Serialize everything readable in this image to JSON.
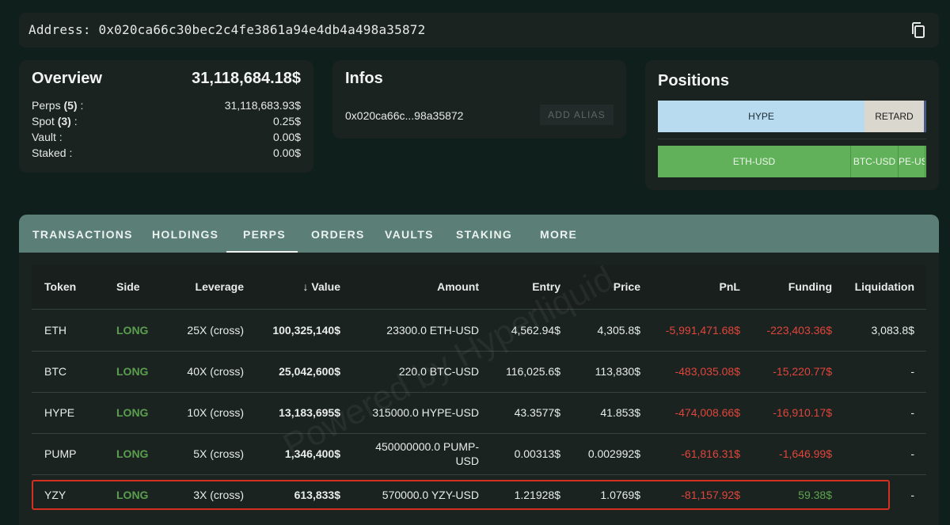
{
  "address_bar": {
    "text": "Address: 0x020ca66c30bec2c4fe3861a94e4db4a498a35872",
    "copy_icon": "copy-icon"
  },
  "overview": {
    "title": "Overview",
    "total": "31,118,684.18$",
    "rows": [
      {
        "label": "Perps",
        "count": "(5)",
        "suffix": " :",
        "value": "31,118,683.93$"
      },
      {
        "label": "Spot",
        "count": "(3)",
        "suffix": " :",
        "value": "0.25$"
      },
      {
        "label": "Vault",
        "count": "",
        "suffix": " :",
        "value": "0.00$"
      },
      {
        "label": "Staked",
        "count": "",
        "suffix": " :",
        "value": "0.00$"
      }
    ]
  },
  "infos": {
    "title": "Infos",
    "short_address": "0x020ca66c...98a35872",
    "alias_button": "ADD ALIAS"
  },
  "positions": {
    "title": "Positions",
    "spot_segments": [
      "HYPE",
      "RETARD"
    ],
    "perp_segments": [
      "ETH-USD",
      "BTC-USD",
      "PE-US"
    ]
  },
  "tabs": [
    "TRANSACTIONS",
    "HOLDINGS",
    "PERPS",
    "ORDERS",
    "VAULTS",
    "STAKING",
    "MORE"
  ],
  "active_tab": "PERPS",
  "table": {
    "headers": {
      "token": "Token",
      "side": "Side",
      "leverage": "Leverage",
      "value_arrow": "↓",
      "value": "Value",
      "amount": "Amount",
      "entry": "Entry",
      "price": "Price",
      "pnl": "PnL",
      "funding": "Funding",
      "liquidation": "Liquidation"
    },
    "rows": [
      {
        "token": "ETH",
        "side": "LONG",
        "leverage": "25X (cross)",
        "value": "100,325,140$",
        "amount": "23300.0 ETH-USD",
        "entry": "4,562.94$",
        "price": "4,305.8$",
        "pnl": "-5,991,471.68$",
        "funding": "-223,403.36$",
        "liquidation": "3,083.8$"
      },
      {
        "token": "BTC",
        "side": "LONG",
        "leverage": "40X (cross)",
        "value": "25,042,600$",
        "amount": "220.0 BTC-USD",
        "entry": "116,025.6$",
        "price": "113,830$",
        "pnl": "-483,035.08$",
        "funding": "-15,220.77$",
        "liquidation": "-"
      },
      {
        "token": "HYPE",
        "side": "LONG",
        "leverage": "10X (cross)",
        "value": "13,183,695$",
        "amount": "315000.0 HYPE-USD",
        "entry": "43.3577$",
        "price": "41.853$",
        "pnl": "-474,008.66$",
        "funding": "-16,910.17$",
        "liquidation": "-"
      },
      {
        "token": "PUMP",
        "side": "LONG",
        "leverage": "5X (cross)",
        "value": "1,346,400$",
        "amount": "450000000.0 PUMP-USD",
        "entry": "0.00313$",
        "price": "0.002992$",
        "pnl": "-61,816.31$",
        "funding": "-1,646.99$",
        "liquidation": "-"
      },
      {
        "token": "YZY",
        "side": "LONG",
        "leverage": "3X (cross)",
        "value": "613,833$",
        "amount": "570000.0 YZY-USD",
        "entry": "1.21928$",
        "price": "1.0769$",
        "pnl": "-81,157.92$",
        "funding": "59.38$",
        "liquidation": "-"
      }
    ]
  },
  "watermark": "Powered by Hyperliquid",
  "colors": {
    "background": "#0f1f1c",
    "card": "#1b2321",
    "tab_bar": "#5b7f76",
    "long": "#5a9e4e",
    "negative": "#e0453a",
    "positive": "#5da54e",
    "highlight": "#d4301f"
  }
}
